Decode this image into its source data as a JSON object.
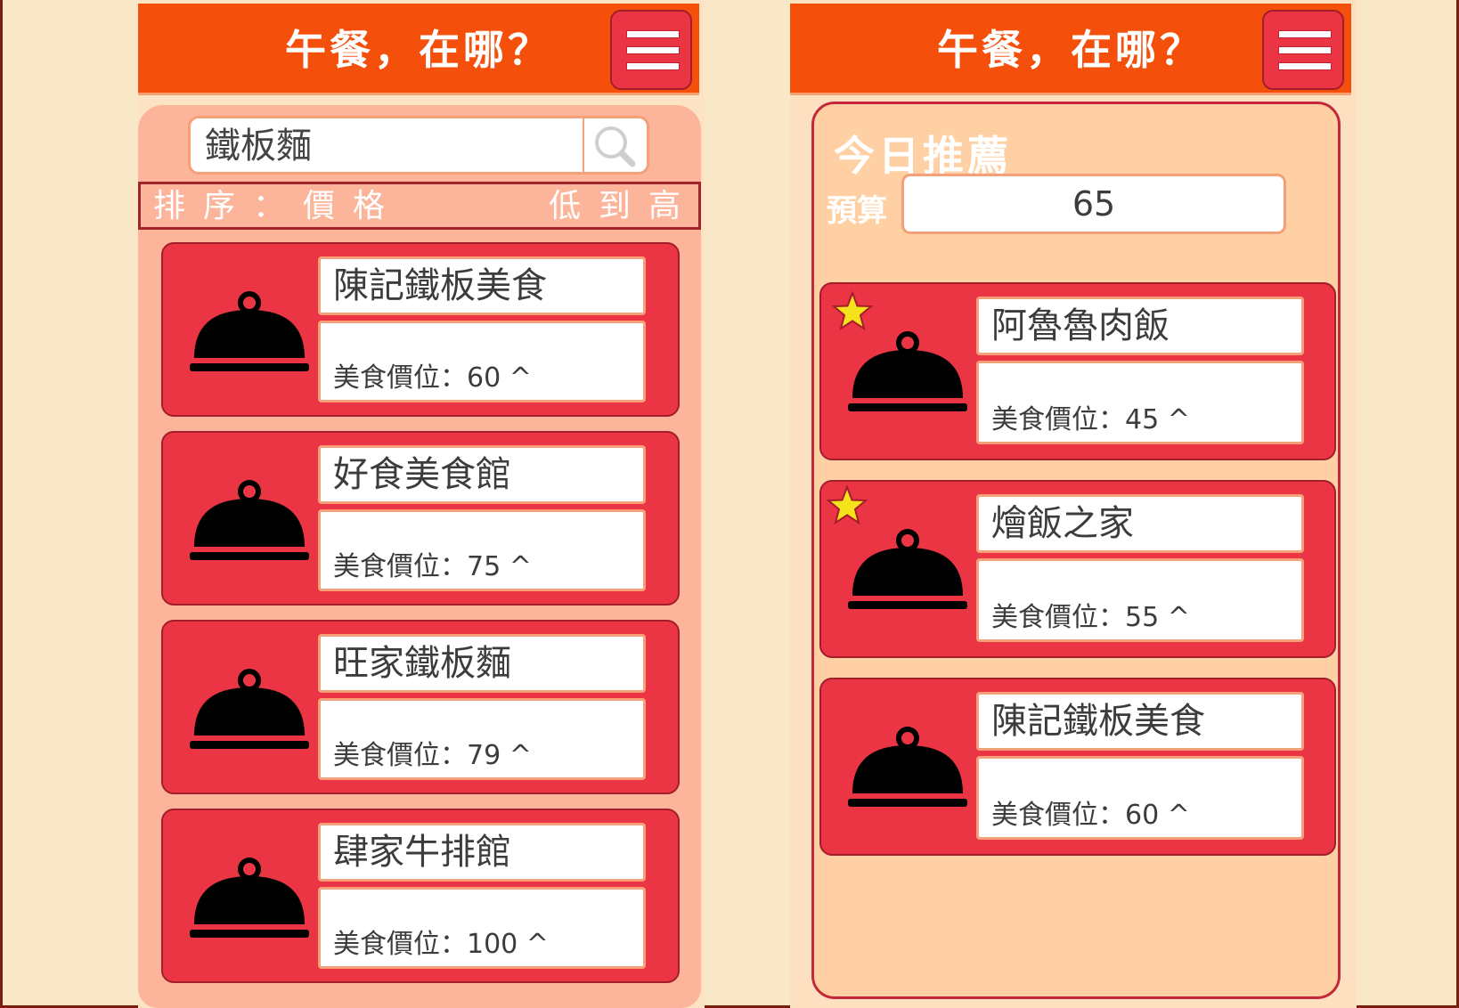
{
  "app": {
    "title": "午餐，在哪？",
    "accent_color": "#f4500b",
    "card_color": "#ec3544"
  },
  "search_screen": {
    "query": "鐵板麵",
    "search_icon": "search-icon",
    "sort_label": "排序：價格",
    "sort_value": "低到高",
    "results": [
      {
        "name": "陳記鐵板美食",
        "price": "美食價位：60 ^",
        "icon": "cloche-icon"
      },
      {
        "name": "好食美食館",
        "price": "美食價位：75 ^",
        "icon": "cloche-icon"
      },
      {
        "name": "旺家鐵板麵",
        "price": "美食價位：79 ^",
        "icon": "cloche-icon"
      },
      {
        "name": "肆家牛排館",
        "price": "美食價位：100 ^",
        "icon": "cloche-icon"
      }
    ]
  },
  "recommend_screen": {
    "title": "今日推薦",
    "budget_label": "預算",
    "budget_value": "65",
    "results": [
      {
        "name": "阿魯魯肉飯",
        "price": "美食價位：45 ^",
        "starred": true
      },
      {
        "name": "燴飯之家",
        "price": "美食價位：55 ^",
        "starred": true
      },
      {
        "name": "陳記鐵板美食",
        "price": "美食價位：60 ^",
        "starred": false
      }
    ]
  }
}
